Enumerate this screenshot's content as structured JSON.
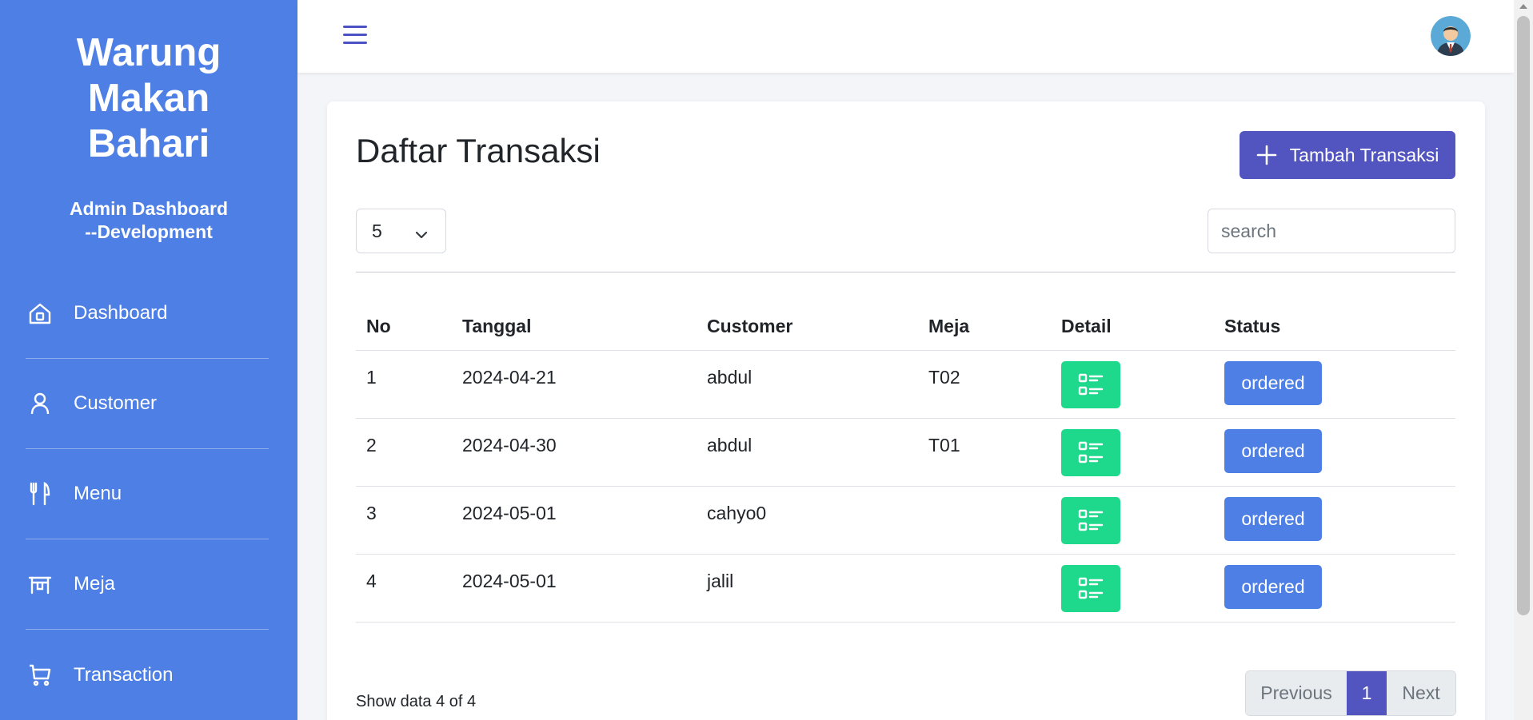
{
  "sidebar": {
    "brand_lines": [
      "Warung",
      "Makan",
      "Bahari"
    ],
    "subtitle_lines": [
      "Admin Dashboard",
      "--Development"
    ],
    "items": [
      {
        "label": "Dashboard",
        "icon": "home-icon"
      },
      {
        "label": "Customer",
        "icon": "user-icon"
      },
      {
        "label": "Menu",
        "icon": "utensils-icon"
      },
      {
        "label": "Meja",
        "icon": "table-icon"
      },
      {
        "label": "Transaction",
        "icon": "cart-icon"
      }
    ]
  },
  "topbar": {
    "menu_icon": "hamburger-icon",
    "avatar_icon": "avatar-icon"
  },
  "main": {
    "title": "Daftar Transaksi",
    "add_button_label": "Tambah Transaksi",
    "page_size": "5",
    "search_placeholder": "search",
    "table": {
      "headers": [
        "No",
        "Tanggal",
        "Customer",
        "Meja",
        "Detail",
        "Status"
      ],
      "rows": [
        {
          "no": "1",
          "tanggal": "2024-04-21",
          "customer": "abdul",
          "meja": "T02",
          "status": "ordered"
        },
        {
          "no": "2",
          "tanggal": "2024-04-30",
          "customer": "abdul",
          "meja": "T01",
          "status": "ordered"
        },
        {
          "no": "3",
          "tanggal": "2024-05-01",
          "customer": "cahyo0",
          "meja": "",
          "status": "ordered"
        },
        {
          "no": "4",
          "tanggal": "2024-05-01",
          "customer": "jalil",
          "meja": "",
          "status": "ordered"
        }
      ]
    },
    "show_data": "Show data 4 of 4",
    "pagination": {
      "previous": "Previous",
      "current": "1",
      "next": "Next"
    }
  },
  "colors": {
    "sidebar": "#4e7fe4",
    "primary": "#5254c0",
    "success": "#1ed98b",
    "status": "#4e7fe4"
  }
}
